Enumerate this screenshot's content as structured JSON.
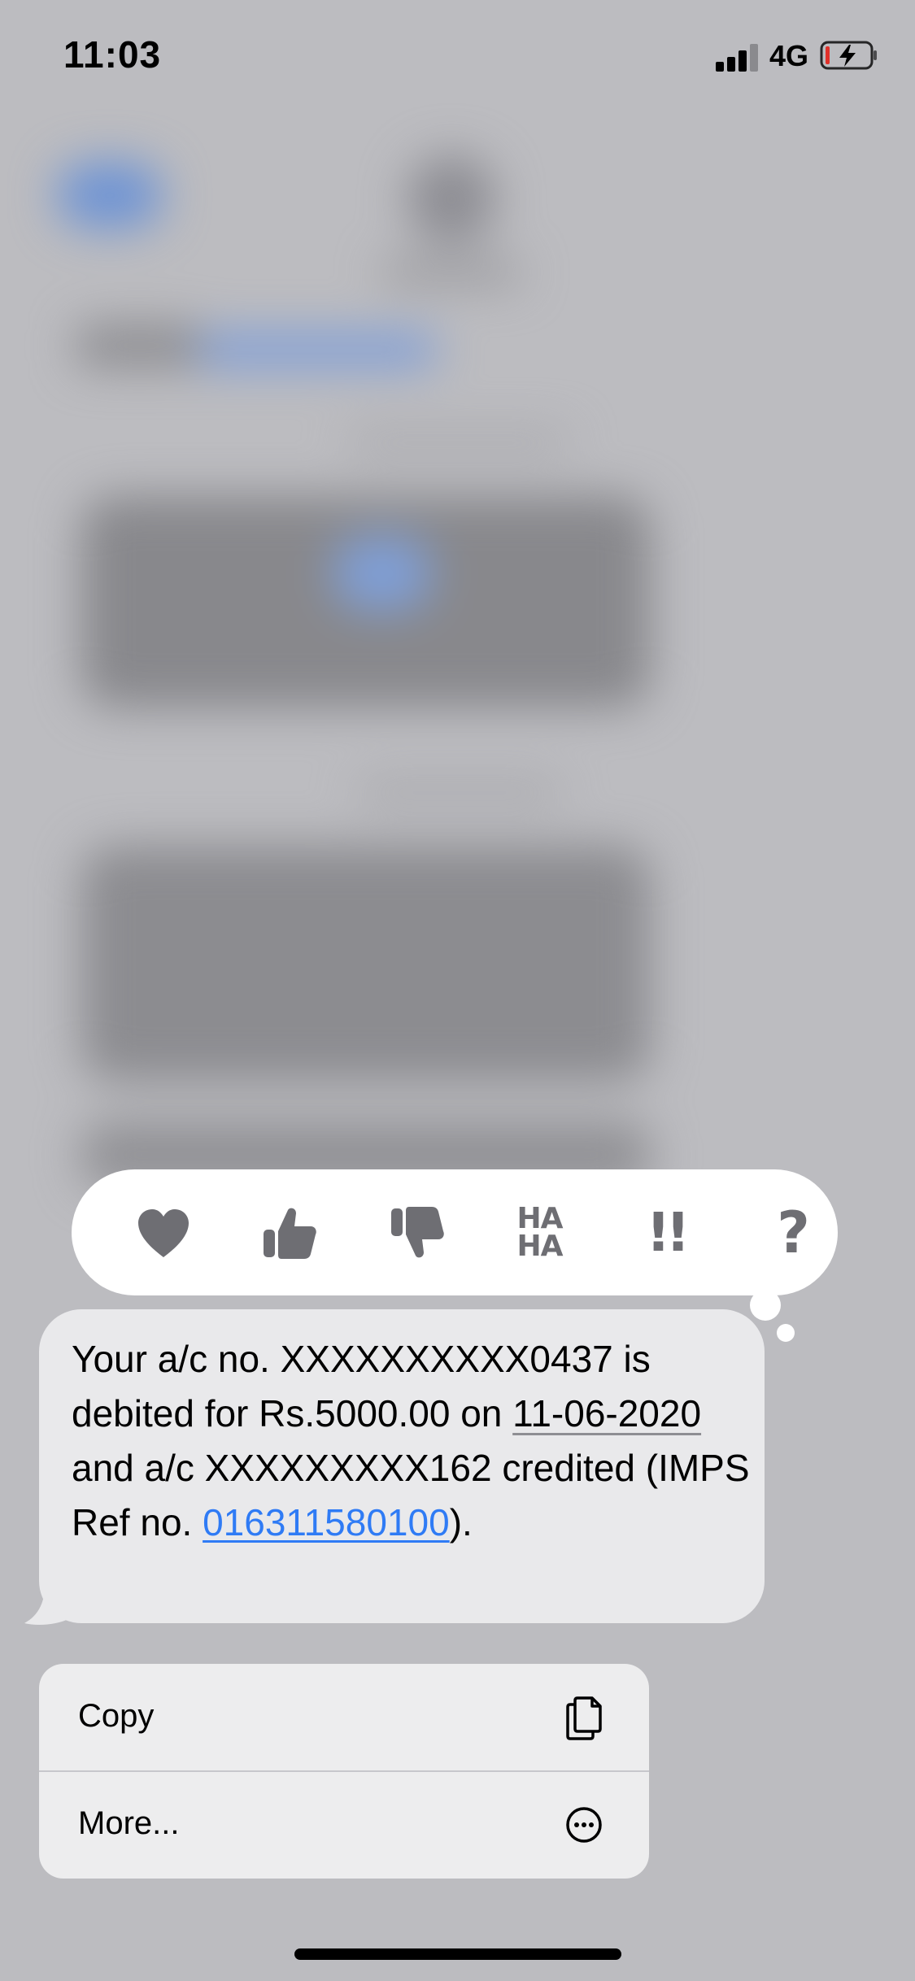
{
  "status_bar": {
    "time": "11:03",
    "network": "4G"
  },
  "reactions": [
    {
      "name": "heart",
      "icon": "heart-icon"
    },
    {
      "name": "thumbs-up",
      "icon": "thumbs-up-icon"
    },
    {
      "name": "thumbs-down",
      "icon": "thumbs-down-icon"
    },
    {
      "name": "haha",
      "icon": "haha-icon",
      "text_top": "HA",
      "text_bottom": "HA"
    },
    {
      "name": "emphasize",
      "icon": "double-exclamation-icon",
      "text": "!!"
    },
    {
      "name": "question",
      "icon": "question-icon",
      "text": "?"
    }
  ],
  "message": {
    "part1": "Your a/c no. XXXXXXXXXX0437 is debited for Rs.5000.00 on ",
    "date": "11-06-2020",
    "part2": " and a/c XXXXXXXXX162 credited (IMPS Ref no. ",
    "ref_link": "016311580100",
    "part3": ")."
  },
  "context_menu": {
    "copy_label": "Copy",
    "more_label": "More..."
  },
  "colors": {
    "background": "#bcbcc0",
    "bubble": "#e9e9eb",
    "link": "#2f7bf5",
    "reaction_icon": "#6e6e73",
    "menu": "#ededee"
  }
}
